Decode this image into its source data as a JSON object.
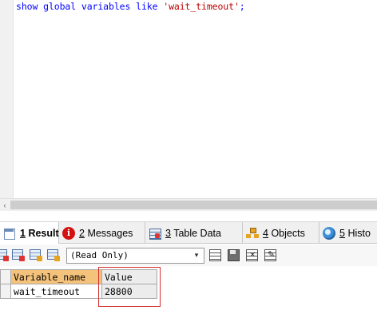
{
  "editor": {
    "query": {
      "keywords": "show global variables like ",
      "string": "'wait_timeout'",
      "terminator": ";"
    }
  },
  "result_tabs": [
    {
      "number": "1",
      "label": "Result",
      "icon": "result-grid-icon",
      "active": true
    },
    {
      "number": "2",
      "label": "Messages",
      "icon": "info-icon",
      "active": false
    },
    {
      "number": "3",
      "label": "Table Data",
      "icon": "table-data-icon",
      "active": false
    },
    {
      "number": "4",
      "label": "Objects",
      "icon": "objects-icon",
      "active": false
    },
    {
      "number": "5",
      "label": "Histo",
      "icon": "history-icon",
      "active": false
    }
  ],
  "toolbar": {
    "mode_select": "(Read Only)"
  },
  "grid": {
    "columns": [
      "Variable_name",
      "Value"
    ],
    "rows": [
      [
        "wait_timeout",
        "28800"
      ]
    ]
  },
  "colors": {
    "keyword": "#0000ff",
    "string": "#c00000",
    "selected_header": "#f4c27a",
    "annotation_box": "#d22c2c"
  }
}
